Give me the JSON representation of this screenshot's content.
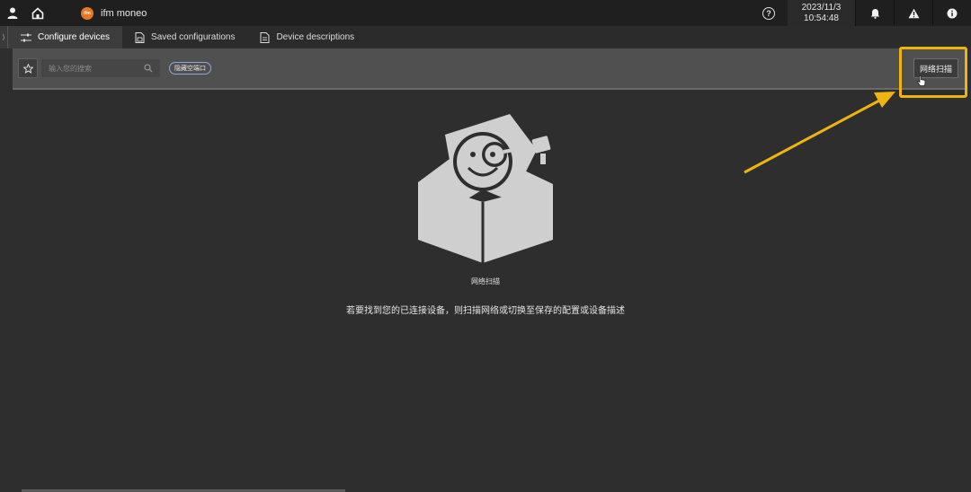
{
  "app": {
    "brand_logo_text": "ifm",
    "name": "ifm moneo"
  },
  "topbar": {
    "date": "2023/11/3",
    "time": "10:54:48",
    "help_glyph": "?",
    "icons": [
      "user-icon",
      "home-icon",
      "help-icon",
      "bell-icon",
      "warning-icon",
      "info-icon"
    ]
  },
  "tabs": [
    {
      "label": "Configure devices",
      "icon": "sliders-icon",
      "active": true
    },
    {
      "label": "Saved configurations",
      "icon": "saved-file-icon",
      "active": false
    },
    {
      "label": "Device descriptions",
      "icon": "description-file-icon",
      "active": false
    }
  ],
  "toolbar": {
    "search_placeholder": "输入您的搜索",
    "chip_label": "隐藏空端口",
    "scan_button_label": "网络扫描"
  },
  "empty_state": {
    "title": "网络扫描",
    "message": "若要找到您的已连接设备，则扫描网络或切换至保存的配置或设备描述",
    "illustration": "box-with-face-icon"
  },
  "colors": {
    "highlight": "#f0b40e",
    "brand": "#e87722",
    "chip_border": "#8aa9d6"
  }
}
